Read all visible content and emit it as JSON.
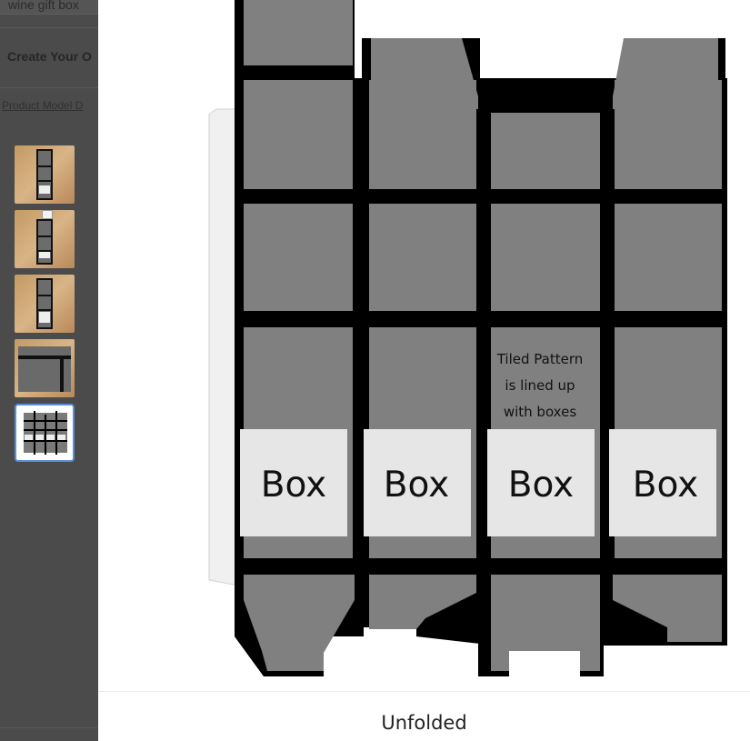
{
  "background_page": {
    "search_value": "wine gift box",
    "cta_label": "Create Your O",
    "link_label": "Product Model D"
  },
  "thumbnails": [
    {
      "name": "closed-box-view",
      "selected": false
    },
    {
      "name": "open-lid-view",
      "selected": false
    },
    {
      "name": "front-label-view",
      "selected": false
    },
    {
      "name": "detail-view",
      "selected": false
    },
    {
      "name": "unfolded-view",
      "selected": true
    }
  ],
  "viewer": {
    "annotation_lines": [
      "Tiled Pattern",
      "is lined up",
      "with boxes"
    ],
    "box_labels": [
      "Box",
      "Box",
      "Box",
      "Box"
    ],
    "caption": "Unfolded"
  },
  "colors": {
    "panel_gray": "#808080",
    "pattern_black": "#000000",
    "label_white": "#e8e8e8",
    "selected_border": "#5b8fd9"
  }
}
